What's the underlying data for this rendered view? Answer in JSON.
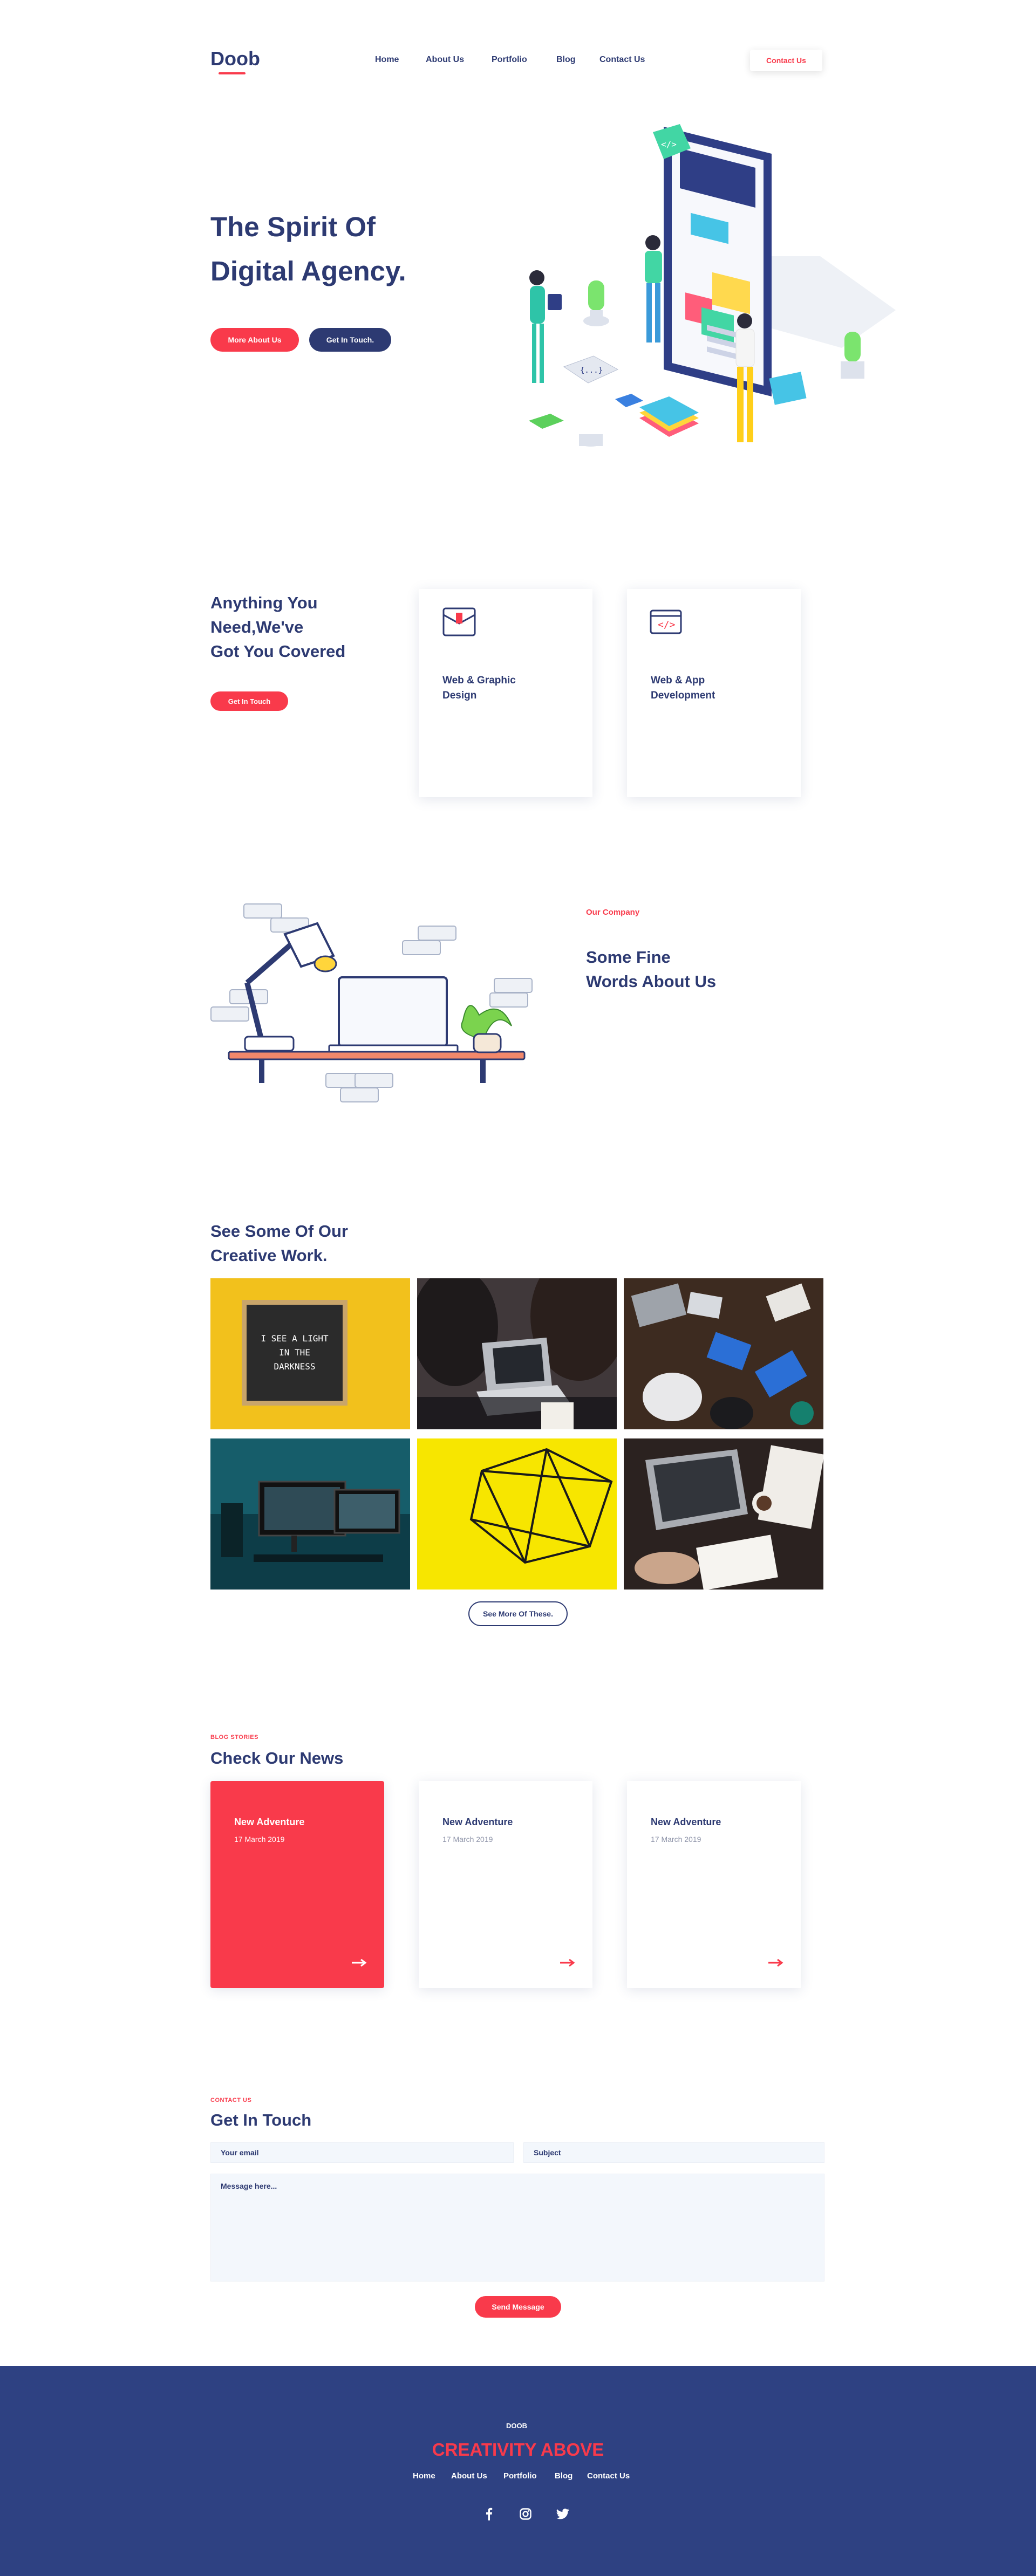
{
  "brand": {
    "logo": "Doob",
    "accent": "#f93a4b",
    "navy": "#2d3a72",
    "footer_bg": "#2e4182"
  },
  "nav": {
    "items": [
      "Home",
      "About Us",
      "Portfolio",
      "Blog",
      "Contact Us"
    ],
    "cta": "Contact Us"
  },
  "hero": {
    "title_line1": "The Spirit Of",
    "title_line2": "Digital Agency.",
    "btn_primary": "More About Us",
    "btn_secondary": "Get In Touch."
  },
  "services": {
    "heading_line1": "Anything You",
    "heading_line2": "Need,We've",
    "heading_line3": "Got You Covered",
    "cta": "Get In Touch",
    "cards": [
      {
        "title_line1": "Web & Graphic",
        "title_line2": "Design",
        "icon": "envelope-icon"
      },
      {
        "title_line1": "Web & App",
        "title_line2": "Development",
        "icon": "code-window-icon"
      }
    ]
  },
  "about": {
    "eyebrow": "Our Company",
    "title_line1": "Some Fine",
    "title_line2": "Words About Us"
  },
  "portfolio": {
    "title_line1": "See Some Of Our",
    "title_line2": "Creative Work.",
    "letterboard_text": [
      "I SEE A LIGHT",
      "IN THE",
      "DARKNESS"
    ],
    "more_button": "See More Of These."
  },
  "blog": {
    "eyebrow": "BLOG STORIES",
    "title": "Check Our News",
    "posts": [
      {
        "title": "New Adventure",
        "date": "17 March 2019"
      },
      {
        "title": "New Adventure",
        "date": "17 March 2019"
      },
      {
        "title": "New Adventure",
        "date": "17 March 2019"
      }
    ]
  },
  "contact": {
    "eyebrow": "CONTACT US",
    "title": "Get In Touch",
    "email_placeholder": "Your email",
    "subject_placeholder": "Subject",
    "message_placeholder": "Message here...",
    "submit": "Send Message"
  },
  "footer": {
    "logo": "DOOB",
    "tagline": "CREATIVITY ABOVE",
    "nav": [
      "Home",
      "About Us",
      "Portfolio",
      "Blog",
      "Contact Us"
    ],
    "social": [
      "facebook-icon",
      "instagram-icon",
      "twitter-icon"
    ]
  }
}
